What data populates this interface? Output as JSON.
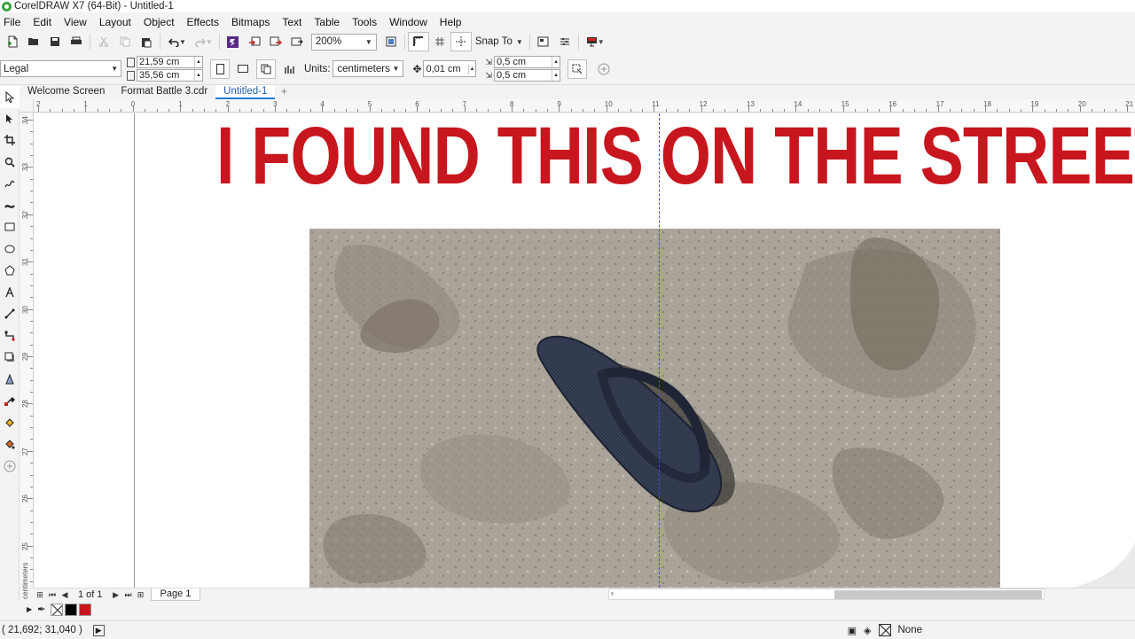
{
  "window": {
    "title": "CorelDRAW X7 (64-Bit) - Untitled-1"
  },
  "menu": [
    "File",
    "Edit",
    "View",
    "Layout",
    "Object",
    "Effects",
    "Bitmaps",
    "Text",
    "Table",
    "Tools",
    "Window",
    "Help"
  ],
  "toolbar": {
    "zoom_value": "200%",
    "snap_to_label": "Snap To"
  },
  "property_bar": {
    "paper_size": "Legal",
    "page_width": "21,59 cm",
    "page_height": "35,56 cm",
    "units_label": "Units:",
    "units_value": "centimeters",
    "nudge_distance": "0,01 cm",
    "duplicate_x": "0,5 cm",
    "duplicate_y": "0,5 cm"
  },
  "tabs": [
    {
      "label": "Welcome Screen",
      "active": false
    },
    {
      "label": "Format Battle 3.cdr",
      "active": false
    },
    {
      "label": "Untitled-1",
      "active": true
    }
  ],
  "rulers": {
    "horizontal_labels": [
      "2",
      "1",
      "0",
      "1",
      "2",
      "3",
      "4",
      "5",
      "6",
      "7",
      "8",
      "9",
      "10",
      "11",
      "12",
      "13",
      "14",
      "15",
      "16",
      "17",
      "18",
      "19",
      "20",
      "21"
    ],
    "vertical_labels": [
      "34",
      "33",
      "32",
      "31",
      "30",
      "29",
      "28",
      "27",
      "26",
      "25"
    ],
    "units": "centimeters"
  },
  "canvas": {
    "headline": "I FOUND THIS ON THE STREET",
    "headline_color": "#c7161e",
    "photo_subject": "flip-flop on concrete"
  },
  "document_nav": {
    "page_count": "1 of 1",
    "page_tab": "Page 1"
  },
  "palette": {
    "swatches": [
      "#000000",
      "#c8161e"
    ]
  },
  "status": {
    "coordinates": "( 21,692; 31,040 )",
    "fill_label": "None"
  }
}
